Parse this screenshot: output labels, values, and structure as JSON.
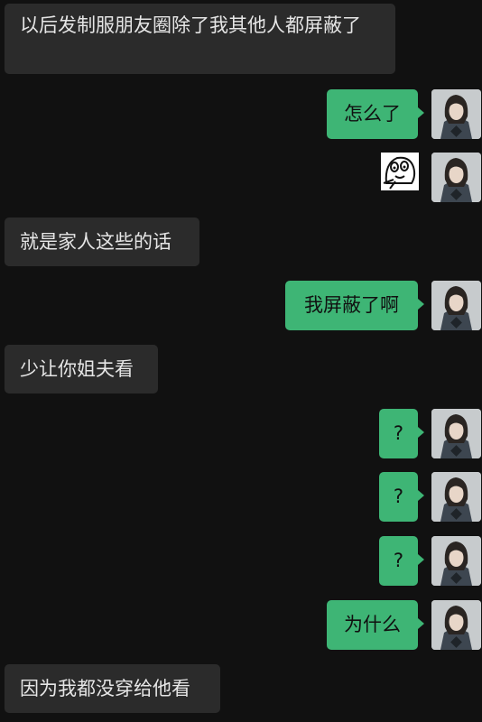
{
  "messages": [
    {
      "side": "in",
      "text": "以后发制服朋友圈除了我其他人都屏蔽了"
    },
    {
      "side": "out",
      "text": "怎么了"
    },
    {
      "side": "out",
      "type": "sticker",
      "icon": "cartoon-face-sticker-icon"
    },
    {
      "side": "in",
      "text": "就是家人这些的话"
    },
    {
      "side": "out",
      "text": "我屏蔽了啊"
    },
    {
      "side": "in",
      "text": "少让你姐夫看"
    },
    {
      "side": "out",
      "text": "?"
    },
    {
      "side": "out",
      "text": "?"
    },
    {
      "side": "out",
      "text": "?"
    },
    {
      "side": "out",
      "text": "为什么"
    },
    {
      "side": "in",
      "text": "因为我都没穿给他看"
    }
  ],
  "colors": {
    "background": "#111111",
    "incoming_bubble": "#2b2b2b",
    "outgoing_bubble": "#3eb575"
  }
}
